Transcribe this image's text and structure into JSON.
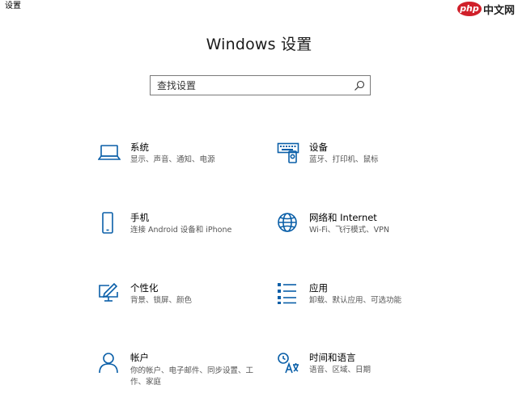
{
  "window": {
    "app_title": "设置"
  },
  "watermark": {
    "php": "php",
    "site": "中文网"
  },
  "header": {
    "title": "Windows 设置"
  },
  "search": {
    "placeholder": "查找设置",
    "value": ""
  },
  "tiles": [
    {
      "icon": "laptop-icon",
      "label": "系统",
      "desc": "显示、声音、通知、电源"
    },
    {
      "icon": "keyboard-devices-icon",
      "label": "设备",
      "desc": "蓝牙、打印机、鼠标"
    },
    {
      "icon": "phone-icon",
      "label": "手机",
      "desc": "连接 Android 设备和 iPhone"
    },
    {
      "icon": "globe-icon",
      "label": "网络和 Internet",
      "desc": "Wi-Fi、飞行模式、VPN"
    },
    {
      "icon": "pen-monitor-icon",
      "label": "个性化",
      "desc": "背景、锁屏、颜色"
    },
    {
      "icon": "apps-list-icon",
      "label": "应用",
      "desc": "卸载、默认应用、可选功能"
    },
    {
      "icon": "person-icon",
      "label": "帐户",
      "desc": "你的帐户、电子邮件、同步设置、工作、家庭"
    },
    {
      "icon": "time-language-icon",
      "label": "时间和语言",
      "desc": "语音、区域、日期"
    }
  ],
  "colors": {
    "accent": "#0a5fa8",
    "background": "#ffffff",
    "text": "#000000",
    "secondary_text": "#555555"
  }
}
